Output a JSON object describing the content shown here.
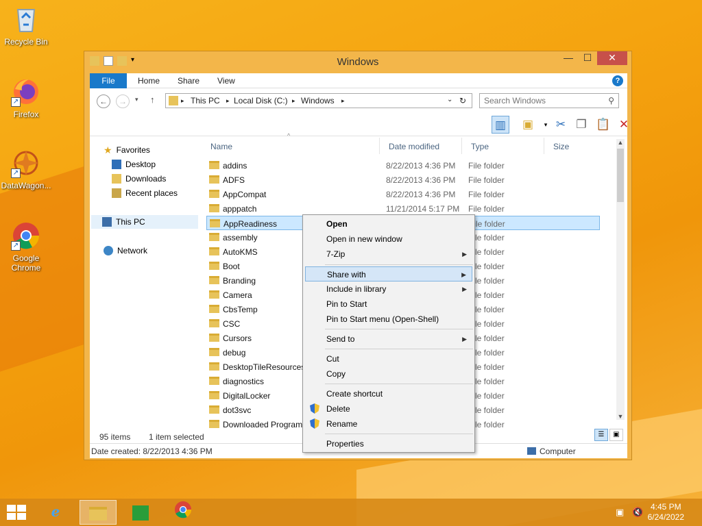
{
  "desktop": {
    "icons": [
      {
        "label": "Recycle Bin"
      },
      {
        "label": "Firefox"
      },
      {
        "label": "DataWagon..."
      },
      {
        "label": "Google Chrome"
      }
    ]
  },
  "window": {
    "title": "Windows",
    "menu": {
      "file": "File",
      "home": "Home",
      "share": "Share",
      "view": "View"
    },
    "breadcrumb": [
      "This PC",
      "Local Disk (C:)",
      "Windows"
    ],
    "search_placeholder": "Search Windows",
    "nav": {
      "favorites": "Favorites",
      "desktop": "Desktop",
      "downloads": "Downloads",
      "recent": "Recent places",
      "this_pc": "This PC",
      "network": "Network"
    },
    "columns": {
      "name": "Name",
      "date": "Date modified",
      "type": "Type",
      "size": "Size"
    },
    "files": [
      {
        "name": "addins",
        "date": "8/22/2013 4:36 PM",
        "type": "File folder"
      },
      {
        "name": "ADFS",
        "date": "8/22/2013 4:36 PM",
        "type": "File folder"
      },
      {
        "name": "AppCompat",
        "date": "8/22/2013 4:36 PM",
        "type": "File folder"
      },
      {
        "name": "apppatch",
        "date": "11/21/2014 5:17 PM",
        "type": "File folder"
      },
      {
        "name": "AppReadiness",
        "date": "",
        "type": "File folder"
      },
      {
        "name": "assembly",
        "date": "",
        "type": "File folder"
      },
      {
        "name": "AutoKMS",
        "date": "",
        "type": "File folder"
      },
      {
        "name": "Boot",
        "date": "",
        "type": "File folder"
      },
      {
        "name": "Branding",
        "date": "",
        "type": "File folder"
      },
      {
        "name": "Camera",
        "date": "",
        "type": "File folder"
      },
      {
        "name": "CbsTemp",
        "date": "",
        "type": "File folder"
      },
      {
        "name": "CSC",
        "date": "",
        "type": "File folder"
      },
      {
        "name": "Cursors",
        "date": "",
        "type": "File folder"
      },
      {
        "name": "debug",
        "date": "",
        "type": "File folder"
      },
      {
        "name": "DesktopTileResources",
        "date": "",
        "type": "File folder"
      },
      {
        "name": "diagnostics",
        "date": "",
        "type": "File folder"
      },
      {
        "name": "DigitalLocker",
        "date": "",
        "type": "File folder"
      },
      {
        "name": "dot3svc",
        "date": "",
        "type": "File folder"
      },
      {
        "name": "Downloaded Program Files",
        "date": "",
        "type": "File folder"
      }
    ],
    "status": {
      "count": "95 items",
      "selected": "1 item selected"
    },
    "info": {
      "created": "Date created: 8/22/2013 4:36 PM",
      "location": "Computer"
    }
  },
  "context_menu": {
    "open": "Open",
    "open_new": "Open in new window",
    "zip": "7-Zip",
    "share_with": "Share with",
    "include_library": "Include in library",
    "pin_start": "Pin to Start",
    "pin_start_menu": "Pin to Start menu (Open-Shell)",
    "send_to": "Send to",
    "cut": "Cut",
    "copy": "Copy",
    "create_shortcut": "Create shortcut",
    "delete": "Delete",
    "rename": "Rename",
    "properties": "Properties"
  },
  "taskbar": {
    "time": "4:45 PM",
    "date": "6/24/2022"
  },
  "colors": {
    "accent": "#1979ca",
    "selection": "#cce8ff",
    "taskbar": "#d68816"
  },
  "icons": {
    "recycle_bin": "recycle-bin-icon",
    "firefox": "firefox-icon",
    "chrome": "chrome-icon",
    "folder": "folder-icon",
    "shield": "uac-shield-icon"
  }
}
